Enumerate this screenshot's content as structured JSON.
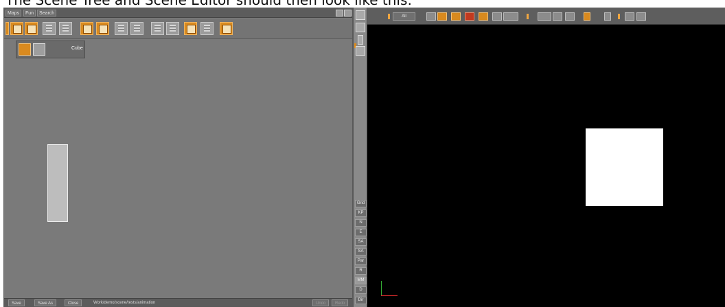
{
  "caption": "The Scene Tree and Scene Editor should then look like this:",
  "scene_tree": {
    "tabs": [
      "Maps",
      "Fun",
      "Search"
    ],
    "nodes": [
      {
        "label": ""
      },
      {
        "label": ""
      },
      {
        "label": "Cube"
      }
    ],
    "bottom_bar": {
      "buttons": [
        "Save",
        "Save As",
        "Close"
      ],
      "path": "Work/demo/scene/tests/animation",
      "right_buttons": [
        "Undo",
        "Redo"
      ]
    }
  },
  "side_strip": {
    "buttons": [
      "Grid",
      "KP",
      "N",
      "E",
      "SA",
      "SA",
      "Par",
      "R",
      "MM",
      "D",
      "Dir"
    ]
  },
  "scene_editor": {
    "view_selector": "All",
    "viewport_background": "#000000",
    "cube_color": "#ffffff",
    "axis_colors": {
      "x": "#d22a2a",
      "y": "#36b236"
    }
  },
  "icons": {
    "toolbar": [
      "orange-group-icon",
      "orange-container-icon",
      "stack-icon",
      "split-icon",
      "search-icon",
      "zoom-icon",
      "expand-tree-icon",
      "collapse-tree-icon",
      "outline-icon",
      "branch-icon",
      "pane-icon",
      "list-icon",
      "properties-icon"
    ]
  }
}
